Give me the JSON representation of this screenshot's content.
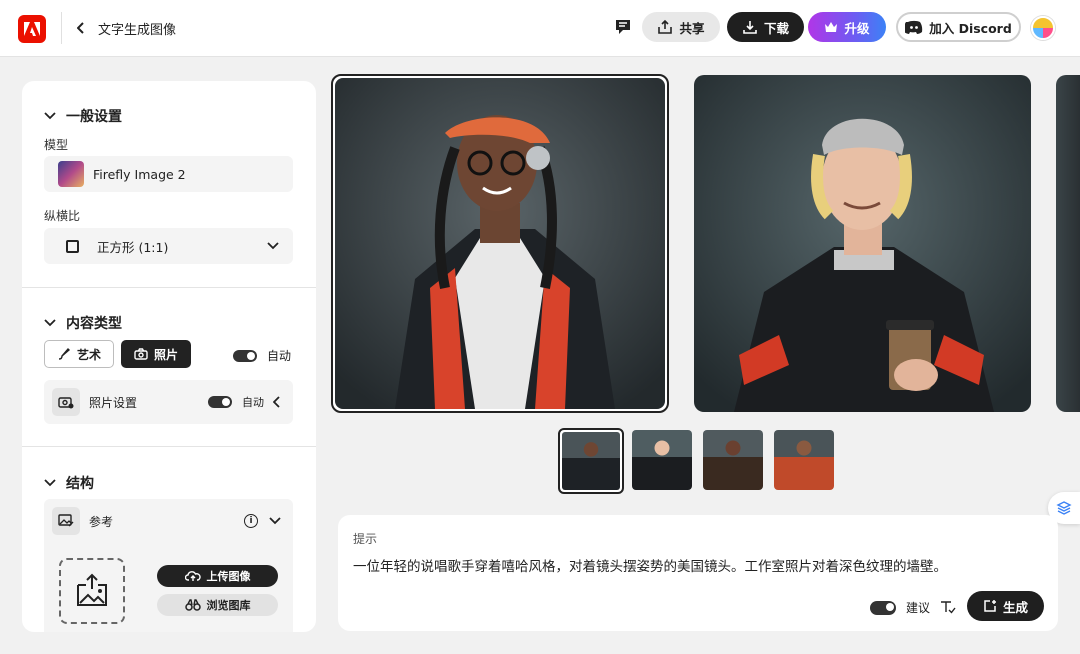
{
  "header": {
    "title": "文字生成图像",
    "share_label": "共享",
    "download_label": "下载",
    "upgrade_label": "升级",
    "discord_label": "加入 Discord"
  },
  "settings": {
    "general_heading": "一般设置",
    "model_label": "模型",
    "model_value": "Firefly Image 2",
    "aspect_label": "纵横比",
    "aspect_value": "正方形 (1:1)",
    "content_heading": "内容类型",
    "art_label": "艺术",
    "photo_label": "照片",
    "auto_label": "自动",
    "photo_settings_label": "照片设置",
    "photo_settings_auto": "自动",
    "structure_heading": "结构",
    "reference_label": "参考",
    "upload_label": "上传图像",
    "browse_label": "浏览图库"
  },
  "prompt": {
    "label": "提示",
    "text": "一位年轻的说唱歌手穿着嘻哈风格，对着镜头摆姿势的美国镜头。工作室照片对着深色纹理的墙壁。",
    "suggest_label": "建议",
    "generate_label": "生成"
  },
  "colors": {
    "adobe_red": "#eb1000",
    "dark": "#1f1f1f",
    "upgrade_gradient_start": "#b136e7",
    "upgrade_gradient_end": "#3c82f6"
  }
}
